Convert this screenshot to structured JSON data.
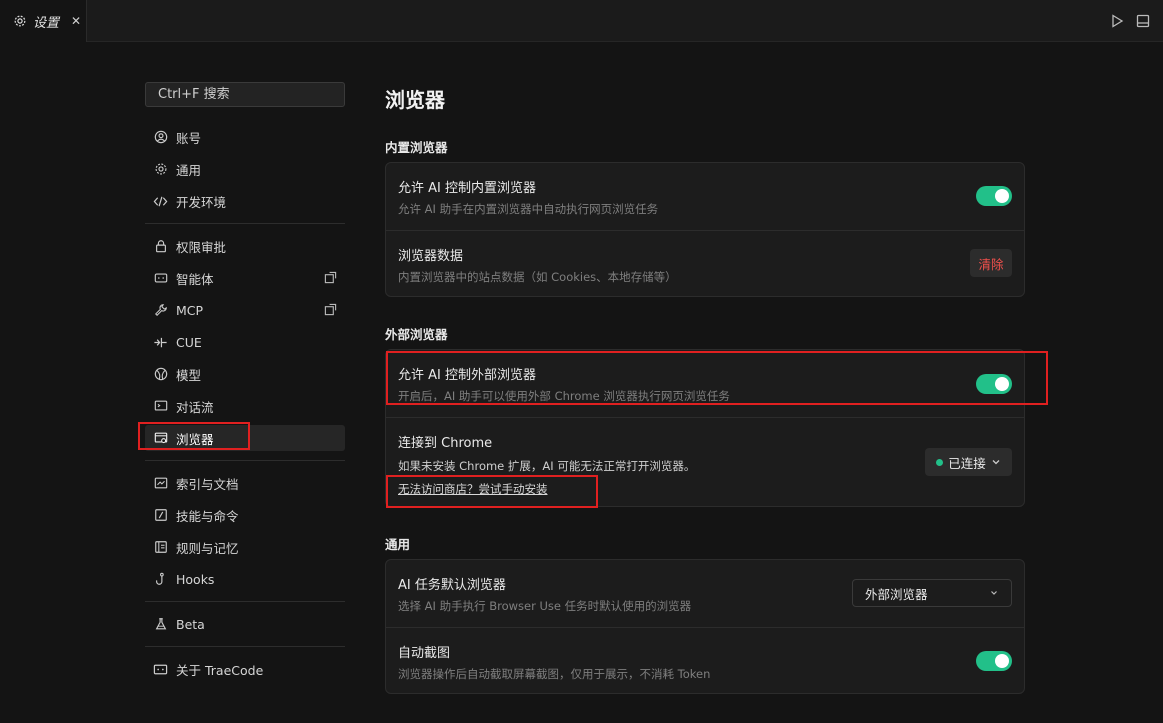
{
  "tab": {
    "label": "设置",
    "close": "✕"
  },
  "sidebar": {
    "search_placeholder": "Ctrl+F 搜索",
    "items": [
      {
        "label": "账号",
        "icon": "account-icon"
      },
      {
        "label": "通用",
        "icon": "gear-icon"
      },
      {
        "label": "开发环境",
        "icon": "code-icon"
      },
      {
        "label": "权限审批",
        "icon": "lock-icon"
      },
      {
        "label": "智能体",
        "icon": "agent-icon"
      },
      {
        "label": "MCP",
        "icon": "wrench-icon"
      },
      {
        "label": "CUE",
        "icon": "cue-icon"
      },
      {
        "label": "模型",
        "icon": "model-icon"
      },
      {
        "label": "对话流",
        "icon": "chat-icon"
      },
      {
        "label": "浏览器",
        "icon": "browser-icon"
      },
      {
        "label": "索引与文档",
        "icon": "index-icon"
      },
      {
        "label": "技能与命令",
        "icon": "skill-icon"
      },
      {
        "label": "规则与记忆",
        "icon": "rules-icon"
      },
      {
        "label": "Hooks",
        "icon": "hook-icon"
      },
      {
        "label": "Beta",
        "icon": "flask-icon"
      },
      {
        "label": "关于 TraeCode",
        "icon": "about-icon"
      }
    ]
  },
  "main": {
    "title": "浏览器",
    "builtin": {
      "section": "内置浏览器",
      "allow_title": "允许 AI 控制内置浏览器",
      "allow_desc": "允许 AI 助手在内置浏览器中自动执行网页浏览任务",
      "data_title": "浏览器数据",
      "data_desc": "内置浏览器中的站点数据（如 Cookies、本地存储等）",
      "clear_label": "清除"
    },
    "external": {
      "section": "外部浏览器",
      "allow_title": "允许 AI 控制外部浏览器",
      "allow_desc": "开启后，AI 助手可以使用外部 Chrome 浏览器执行网页浏览任务",
      "connect_title": "连接到 Chrome",
      "connect_desc": "如果未安装 Chrome 扩展，AI 可能无法正常打开浏览器。",
      "manual_link": "无法访问商店？尝试手动安装",
      "status_label": "已连接"
    },
    "general": {
      "section": "通用",
      "default_title": "AI 任务默认浏览器",
      "default_desc": "选择 AI 助手执行 Browser Use 任务时默认使用的浏览器",
      "default_value": "外部浏览器",
      "screenshot_title": "自动截图",
      "screenshot_desc": "浏览器操作后自动截取屏幕截图，仅用于展示，不消耗 Token"
    }
  },
  "colors": {
    "accent": "#22c089",
    "danger": "#f0504c",
    "highlight": "#e02020"
  }
}
